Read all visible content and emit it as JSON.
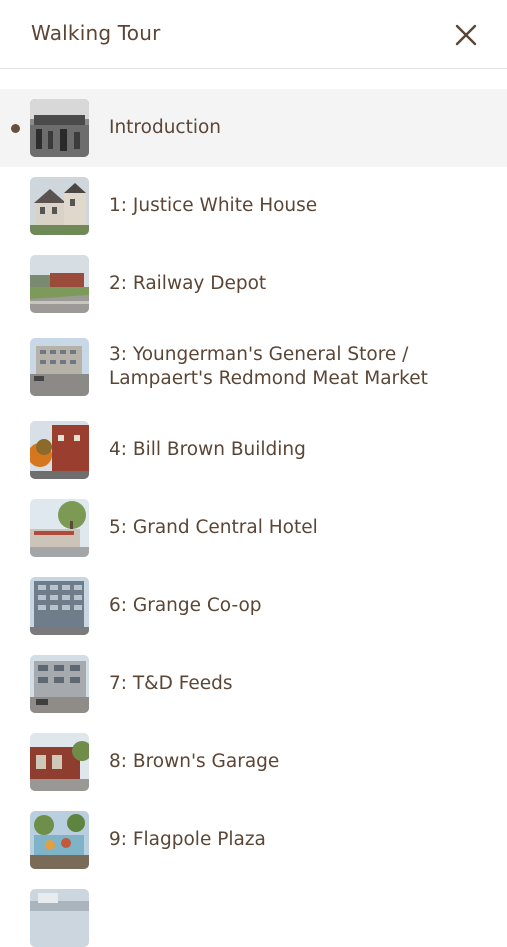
{
  "header": {
    "title": "Walking Tour",
    "close_icon": "close-icon"
  },
  "stops": [
    {
      "label": "Introduction",
      "active": true
    },
    {
      "label": "1: Justice White House"
    },
    {
      "label": "2: Railway Depot"
    },
    {
      "label": "3: Youngerman's General Store / Lampaert's Redmond Meat Market"
    },
    {
      "label": "4: Bill Brown Building"
    },
    {
      "label": "5: Grand Central Hotel"
    },
    {
      "label": "6: Grange Co-op"
    },
    {
      "label": "7: T&D Feeds"
    },
    {
      "label": "8: Brown's Garage"
    },
    {
      "label": "9: Flagpole Plaza"
    }
  ],
  "colors": {
    "text": "#5b4636",
    "active_row": "#f4f4f4",
    "divider": "#e4e4e4"
  }
}
